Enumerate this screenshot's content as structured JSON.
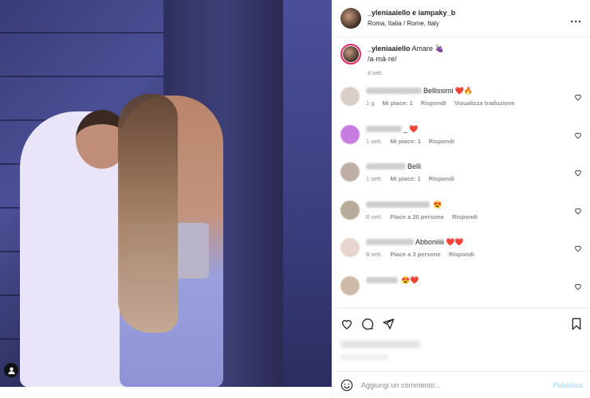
{
  "header": {
    "user": "_yleniaaiello e iampaky_b",
    "location": "Roma, Italia / Rome, Italy",
    "more": "..."
  },
  "caption": {
    "user": "_yleniaaiello",
    "text": "Amare",
    "emoji": "🍇",
    "phonetic": "/a·mà·re/",
    "time": "8 sett."
  },
  "comments": [
    {
      "text": "Bellissimi",
      "emojis": "❤️🔥",
      "meta": [
        "1 g",
        "Mi piace: 1"
      ],
      "links": [
        "Rispondi",
        "Visualizza traduzione"
      ]
    },
    {
      "text": "_",
      "emojis": "❤️",
      "meta": [
        "1 sett.",
        "Mi piace: 1"
      ],
      "links": [
        "Rispondi"
      ]
    },
    {
      "text": "Belli",
      "emojis": "",
      "meta": [
        "1 sett.",
        "Mi piace: 1"
      ],
      "links": [
        "Rispondi"
      ]
    },
    {
      "text": "",
      "emojis": "😍",
      "meta": [
        "8 sett.",
        "Piace a 20 persone"
      ],
      "links": [
        "Rispondi"
      ]
    },
    {
      "text": "Abboniiiii",
      "emojis": "❤️❤️",
      "meta": [
        "8 sett.",
        "Piace a 3 persone"
      ],
      "links": [
        "Rispondi"
      ]
    },
    {
      "text": "",
      "emojis": "😍❤️",
      "meta": [],
      "links": []
    }
  ],
  "add_comment": {
    "placeholder": "Aggiungi un commento...",
    "post": "Pubblica"
  },
  "colors": {
    "accent": "#0095f6",
    "heart": "#e0262f"
  }
}
